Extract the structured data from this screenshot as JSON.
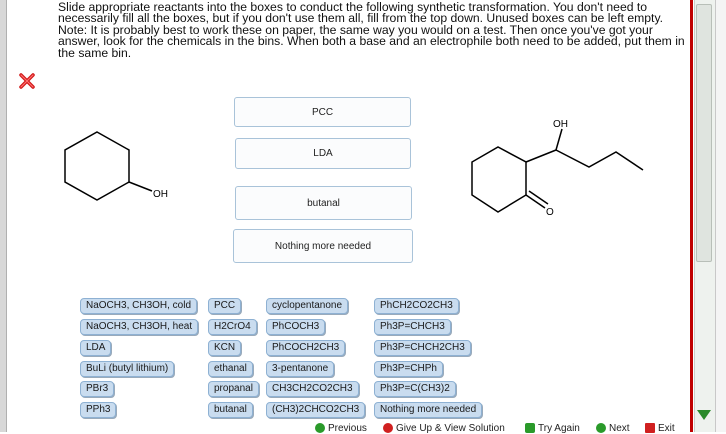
{
  "instructions": {
    "p1": "Slide appropriate reactants into the boxes to conduct the following synthetic transformation.  You don't need to necessarily fill all the boxes, but if you don't use them all, fill from the top down.  Unused boxes can be left empty.",
    "p2": "Note:  It is probably best to work these on paper, the same way you would on a test.  Then once you've got your answer, look for the chemicals in the bins.  When both a base and an electrophile both need to be added, put them in the same bin."
  },
  "answer_boxes": [
    "PCC",
    "LDA",
    "butanal",
    "Nothing more needed"
  ],
  "molecules": {
    "start_label": "OH",
    "product_oh_label": "OH",
    "product_o_label": "O"
  },
  "bins": {
    "col1": [
      "NaOCH3, CH3OH, cold",
      "NaOCH3, CH3OH, heat",
      "LDA",
      "BuLi (butyl lithium)",
      "PBr3",
      "PPh3"
    ],
    "col2": [
      "PCC",
      "H2CrO4",
      "KCN",
      "ethanal",
      "propanal",
      "butanal"
    ],
    "col3": [
      "cyclopentanone",
      "PhCOCH3",
      "PhCOCH2CH3",
      "3-pentanone",
      "CH3CH2CO2CH3",
      "(CH3)2CHCO2CH3"
    ],
    "col4": [
      "PhCH2CO2CH3",
      "Ph3P=CHCH3",
      "Ph3P=CHCH2CH3",
      "Ph3P=CHPh",
      "Ph3P=C(CH3)2",
      "Nothing more needed"
    ]
  },
  "nav": {
    "previous": "Previous",
    "give_up": "Give Up & View Solution",
    "try_again": "Try Again",
    "next": "Next",
    "exit": "Exit"
  },
  "colors": {
    "bin_fill": "#c9dcef",
    "accent_red": "#c00000",
    "nav_green": "#2a8a2a"
  }
}
